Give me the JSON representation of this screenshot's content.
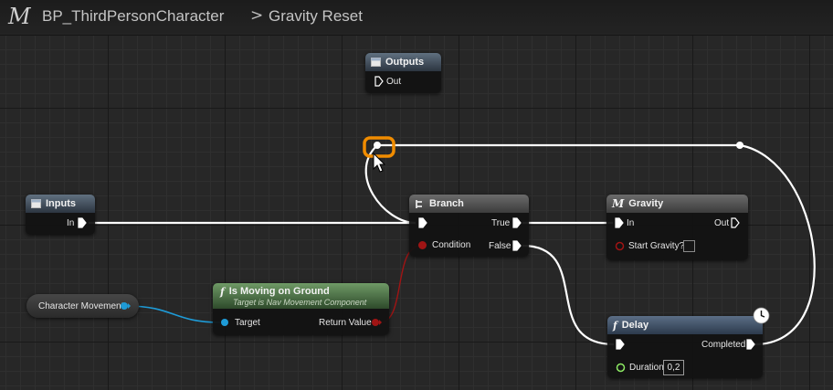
{
  "breadcrumb": {
    "logo": "M",
    "blueprint": "BP_ThirdPersonCharacter",
    "separator": ">",
    "graph": "Gravity Reset"
  },
  "nodes": {
    "outputs": {
      "title": "Outputs",
      "out_label": "Out"
    },
    "inputs": {
      "title": "Inputs",
      "in_label": "In"
    },
    "branch": {
      "title": "Branch",
      "true_label": "True",
      "false_label": "False",
      "condition_label": "Condition"
    },
    "gravity": {
      "title": "Gravity",
      "in_label": "In",
      "out_label": "Out",
      "start_label": "Start Gravity?"
    },
    "character_movement": {
      "label": "Character Movement"
    },
    "is_moving": {
      "title": "Is Moving on Ground",
      "subtitle": "Target is Nav Movement Component",
      "target_label": "Target",
      "return_label": "Return Value"
    },
    "delay": {
      "title": "Delay",
      "completed_label": "Completed",
      "duration_label": "Duration",
      "duration_value": "0,2"
    }
  },
  "colors": {
    "exec_wire": "#ffffff",
    "object_pin": "#1e9bd7",
    "bool_pin": "#a01414",
    "float_pin": "#8dea64",
    "reroute_highlight": "#f08c00"
  },
  "icons": {
    "macro": "macro-m-icon",
    "function": "function-f-icon",
    "branch": "branch-icon",
    "tunnel": "tunnel-node-icon",
    "clock": "latent-clock-icon",
    "cursor": "mouse-cursor-icon"
  }
}
